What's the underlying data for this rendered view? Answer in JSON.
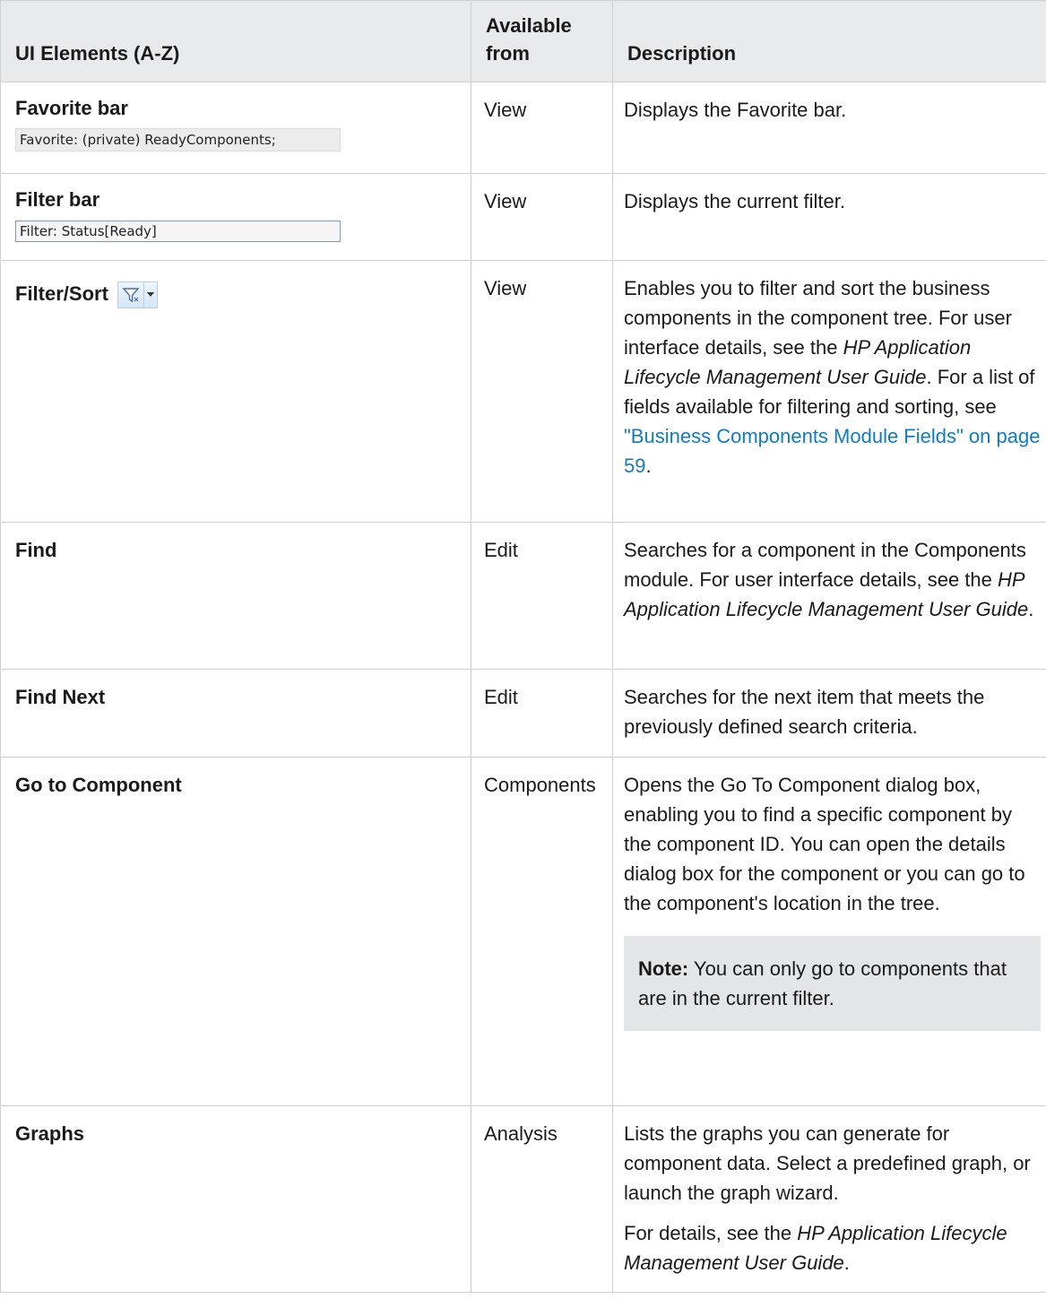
{
  "table": {
    "headers": {
      "element": "UI Elements (A-Z)",
      "available": "Available from",
      "description": "Description"
    },
    "rows": {
      "favorite_bar": {
        "name": "Favorite bar",
        "sample": "Favorite: (private) ReadyComponents;",
        "available": "View",
        "description": "Displays the Favorite bar."
      },
      "filter_bar": {
        "name": "Filter bar",
        "sample": "Filter: Status[Ready]",
        "available": "View",
        "description": "Displays the current filter."
      },
      "filter_sort": {
        "name": "Filter/Sort",
        "icon": "filter-funnel-dropdown-icon",
        "available": "View",
        "description_1": "Enables you to filter and sort the business components in the component tree. For user interface details, see the ",
        "guide": "HP Application Lifecycle Management User Guide",
        "description_2": ". For a list of fields available for filtering and sorting, see ",
        "link": "\"Business Components Module Fields\" on page 59",
        "description_3": "."
      },
      "find": {
        "name": "Find",
        "available": "Edit",
        "description_1": "Searches for a component in the Components module. For user interface details, see the ",
        "guide": "HP Application Lifecycle Management User Guide",
        "description_2": "."
      },
      "find_next": {
        "name": "Find Next",
        "available": "Edit",
        "description": "Searches for the next item that meets the previously defined search criteria."
      },
      "go_to_component": {
        "name": "Go to Component",
        "available": "Components",
        "description": "Opens the Go To Component dialog box, enabling you to find a specific component by the component ID. You can open the details dialog box for the component or you can go to the component's location in the tree.",
        "note_label": "Note:",
        "note_text": " You can only go to components that are in the current filter."
      },
      "graphs": {
        "name": "Graphs",
        "available": "Analysis",
        "description": "Lists the graphs you can generate for component data. Select a predefined graph, or launch the graph wizard.",
        "details_1": "For details, see the ",
        "guide": "HP Application Lifecycle Management User Guide",
        "details_2": "."
      }
    }
  }
}
